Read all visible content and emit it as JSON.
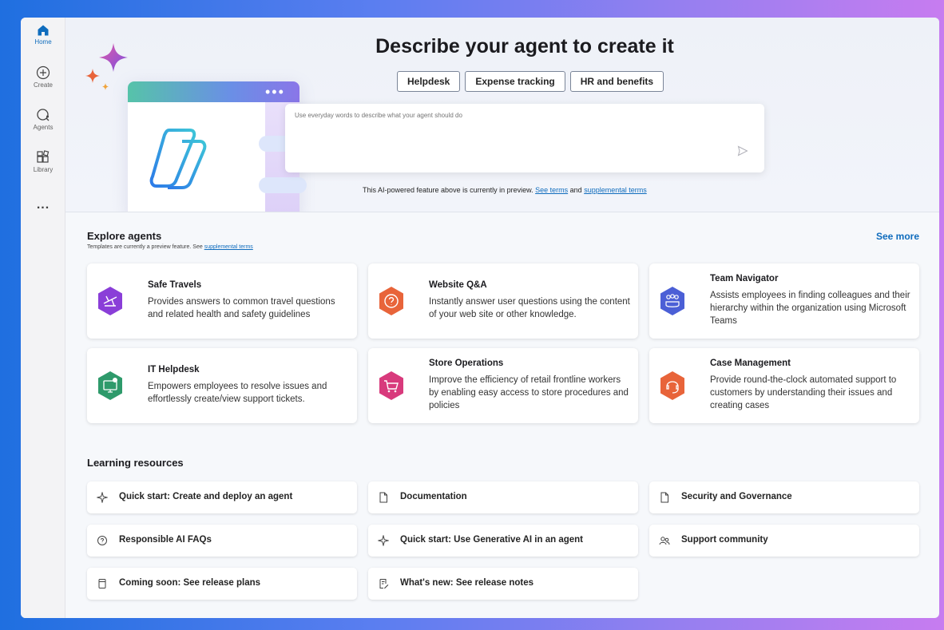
{
  "sidebar": {
    "items": [
      {
        "label": "Home",
        "icon": "home-icon"
      },
      {
        "label": "Create",
        "icon": "plus-circle-icon"
      },
      {
        "label": "Agents",
        "icon": "agents-icon"
      },
      {
        "label": "Library",
        "icon": "library-icon"
      }
    ],
    "more": "..."
  },
  "hero": {
    "title": "Describe your agent to create it",
    "chips": [
      "Helpdesk",
      "Expense tracking",
      "HR and benefits"
    ],
    "prompt_placeholder": "Use everyday words to describe what your agent should do",
    "disclaimer_text": "This AI-powered feature above is currently in preview.",
    "terms_link": "See terms",
    "and_text": "and",
    "supplemental_link": "supplemental terms"
  },
  "explore": {
    "title": "Explore agents",
    "note_text": "Templates are currently a preview feature. See",
    "note_link": "supplemental terms",
    "see_more": "See more",
    "agents": [
      {
        "title": "Safe Travels",
        "desc": "Provides answers to common travel questions and related health and safety guidelines",
        "icon": "airplane-icon",
        "color": "#8a3ed8"
      },
      {
        "title": "Website Q&A",
        "desc": "Instantly answer user questions using the content of your web site or other knowledge.",
        "icon": "question-chat-icon",
        "color": "#e8643a"
      },
      {
        "title": "Team Navigator",
        "desc": "Assists employees in finding colleagues and their hierarchy within the organization using Microsoft Teams",
        "icon": "people-icon",
        "color": "#4b5fd6"
      },
      {
        "title": "IT Helpdesk",
        "desc": "Empowers employees to resolve issues and effortlessly create/view support tickets.",
        "icon": "desktop-help-icon",
        "color": "#2e9a6b"
      },
      {
        "title": "Store Operations",
        "desc": "Improve the efficiency of retail frontline workers by enabling easy access to store procedures and policies",
        "icon": "cart-icon",
        "color": "#d83a7c"
      },
      {
        "title": "Case Management",
        "desc": "Provide round-the-clock automated support to customers by understanding their issues and creating cases",
        "icon": "headset-icon",
        "color": "#e8643a"
      }
    ]
  },
  "learning": {
    "title": "Learning resources",
    "items": [
      {
        "label": "Quick start: Create and deploy an agent",
        "icon": "sparkle-icon"
      },
      {
        "label": "Documentation",
        "icon": "document-icon"
      },
      {
        "label": "Security and Governance",
        "icon": "document-icon"
      },
      {
        "label": "Responsible AI FAQs",
        "icon": "chat-question-icon"
      },
      {
        "label": "Quick start: Use Generative AI in an agent",
        "icon": "sparkle-icon"
      },
      {
        "label": "Support community",
        "icon": "people-community-icon"
      },
      {
        "label": "Coming soon: See release plans",
        "icon": "notebook-icon"
      },
      {
        "label": "What's new: See release notes",
        "icon": "notes-edit-icon"
      }
    ]
  }
}
